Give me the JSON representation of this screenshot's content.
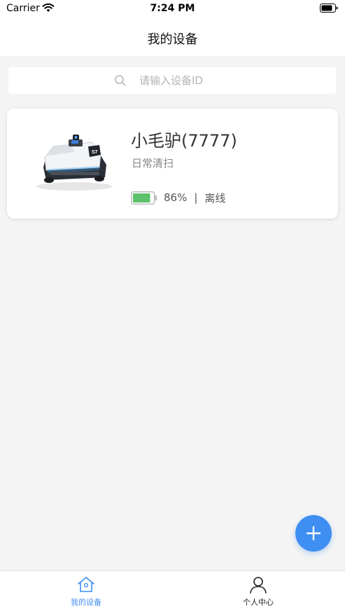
{
  "status_bar": {
    "carrier": "Carrier",
    "time": "7:24 PM"
  },
  "nav": {
    "title": "我的设备"
  },
  "search": {
    "placeholder": "请输入设备ID",
    "value": ""
  },
  "devices": [
    {
      "name": "小毛驴(7777)",
      "mode": "日常清扫",
      "battery": "86%",
      "battery_level": 0.86,
      "separator": "|",
      "connection": "离线",
      "image_label": "S7"
    }
  ],
  "tabs": [
    {
      "label": "我的设备",
      "icon": "home-icon",
      "active": true
    },
    {
      "label": "个人中心",
      "icon": "person-icon",
      "active": false
    }
  ],
  "colors": {
    "accent": "#3f8ef2",
    "battery_fill": "#5cc26b",
    "background": "#f4f4f4"
  },
  "fab": {
    "icon": "plus-icon"
  }
}
